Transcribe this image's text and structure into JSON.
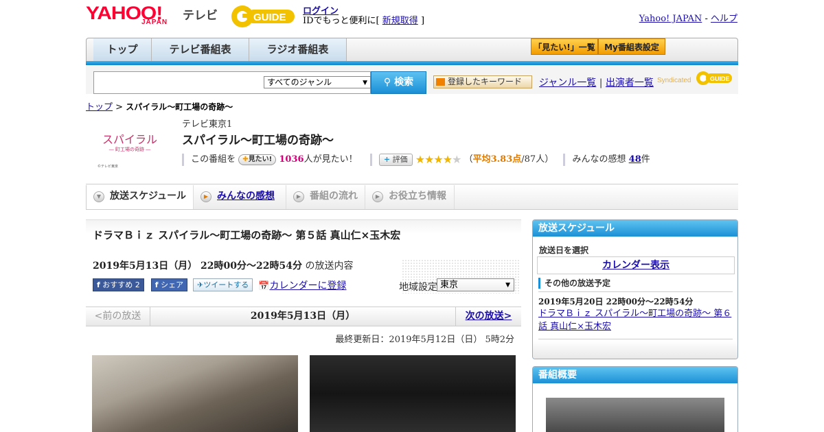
{
  "header": {
    "logo_text": "YAHOO!",
    "logo_sub": "JAPAN",
    "tv_label": "テレビ",
    "gguide_logo": "G-GUIDE",
    "login": "ログイン",
    "login_sub_prefix": "IDでもっと便利に[",
    "signup": "新規取得",
    "login_sub_suffix": "]",
    "yahoo_japan_link": "Yahoo! JAPAN",
    "sep": "-",
    "help_link": "ヘルプ"
  },
  "nav": {
    "tabs": [
      "トップ",
      "テレビ番組表",
      "ラジオ番組表"
    ],
    "mitai_list": "「見たい!」一覧",
    "my_bangumi": "My番組表設定"
  },
  "search": {
    "genre_selected": "すべてのジャンル",
    "search_button": "検索",
    "keyword_button": "登録したキーワード",
    "genre_list": "ジャンル一覧",
    "link_sep": "|",
    "performer_list": "出演者一覧",
    "syndicated": "Syndicated"
  },
  "breadcrumb": {
    "top": "トップ",
    "sep": ">",
    "current": "スパイラル～町工場の奇跡～"
  },
  "program": {
    "thumb_title": "スパイラル",
    "thumb_sub": "― 町工場の奇跡 ―",
    "thumb_credit": "©テレビ東京",
    "channel": "テレビ東京1",
    "title": "スパイラル～町工場の奇跡～",
    "this_program": "この番組を",
    "mitai_button": "見たい!",
    "mitai_count": "1036",
    "mitai_suffix": "人が見たい！",
    "hyoka_button": "評価",
    "rating_stars": 3.5,
    "avg_open": "（",
    "avg_label": "平均3.83点",
    "avg_count": "/87人）",
    "impressions_label": "みんなの感想",
    "impressions_count": "48",
    "impressions_suffix": "件"
  },
  "subtabs": [
    "放送スケジュール",
    "みんなの感想",
    "番組の流れ",
    "お役立ち情報"
  ],
  "episode": {
    "title": "ドラマＢｉｚ スパイラル～町工場の奇跡～ 第５話 真山仁×玉木宏",
    "date_time": "2019年5月13日（月） 22時00分～22時54分",
    "date_suffix": "の放送内容",
    "fb_recommend": "おすすめ 2",
    "fb_share": "シェア",
    "tweet": "ツイートする",
    "calendar_register": "カレンダーに登録",
    "region_label": "地域設定",
    "region_value": "東京"
  },
  "pager": {
    "prev": "<前の放送",
    "date": "2019年5月13日（月）",
    "next": "次の放送>"
  },
  "updated": "最終更新日：2019年5月12日（日） 5時2分",
  "sidebar": {
    "schedule_head": "放送スケジュール",
    "select_date": "放送日を選択",
    "calendar_btn": "カレンダー表示",
    "other_schedule": "その他の放送予定",
    "next_date": "2019年5月20日 22時00分～22時54分",
    "next_title": "ドラマＢｉｚ スパイラル～町工場の奇跡～ 第６話 真山仁×玉木宏",
    "overview_head": "番組概要"
  },
  "colors": {
    "accent_blue": "#1b90d6",
    "yahoo_red": "#ff0033",
    "star": "#f2b500",
    "pink": "#d4007a"
  }
}
